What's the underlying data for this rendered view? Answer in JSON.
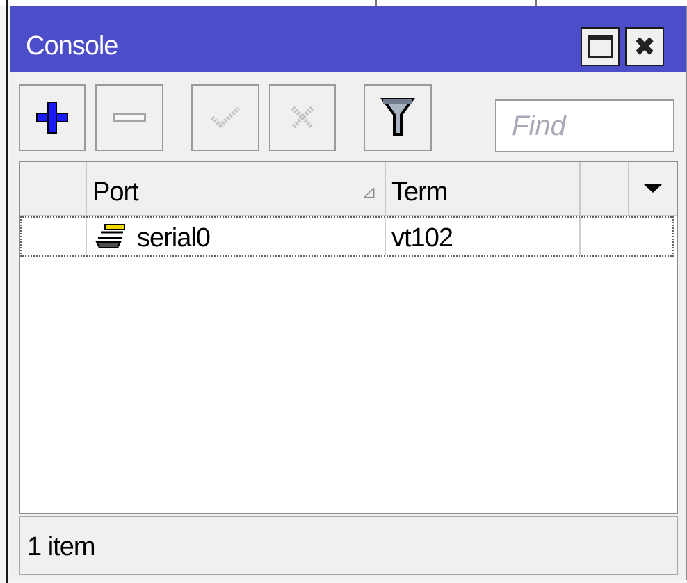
{
  "window": {
    "title": "Console",
    "title_bar_color": "#4c4ec9",
    "controls": [
      "maximize-icon",
      "close-icon"
    ]
  },
  "toolbar": {
    "buttons": [
      {
        "name": "add",
        "icon": "plus-icon",
        "enabled": true
      },
      {
        "name": "remove",
        "icon": "minus-icon",
        "enabled": false
      },
      {
        "name": "enable",
        "icon": "check-icon",
        "enabled": false
      },
      {
        "name": "disable",
        "icon": "x-icon",
        "enabled": false
      },
      {
        "name": "filter",
        "icon": "funnel-icon",
        "enabled": true
      }
    ],
    "find_placeholder": "Find"
  },
  "table": {
    "columns": [
      {
        "key": "flag",
        "label": ""
      },
      {
        "key": "port",
        "label": "Port",
        "sort": "ascending"
      },
      {
        "key": "term",
        "label": "Term"
      },
      {
        "key": "extra",
        "label": ""
      }
    ],
    "rows": [
      {
        "flag": "",
        "icon": "serial-port-icon",
        "port": "serial0",
        "term": "vt102",
        "extra": ""
      }
    ]
  },
  "status": {
    "text": "1 item"
  }
}
